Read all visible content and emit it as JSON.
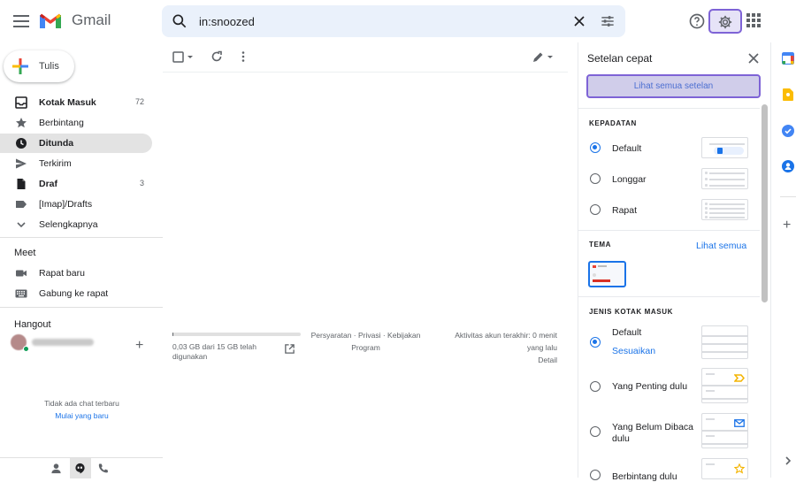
{
  "header": {
    "app_name": "Gmail",
    "search_value": "in:snoozed"
  },
  "sidebar": {
    "compose_label": "Tulis",
    "items": [
      {
        "label": "Kotak Masuk",
        "count": "72"
      },
      {
        "label": "Berbintang",
        "count": ""
      },
      {
        "label": "Ditunda",
        "count": ""
      },
      {
        "label": "Terkirim",
        "count": ""
      },
      {
        "label": "Draf",
        "count": "3"
      },
      {
        "label": "[Imap]/Drafts",
        "count": ""
      },
      {
        "label": "Selengkapnya",
        "count": ""
      }
    ],
    "meet_title": "Meet",
    "meet_items": [
      "Rapat baru",
      "Gabung ke rapat"
    ],
    "hangout_title": "Hangout",
    "hangout_contact": "",
    "no_chat_text": "Tidak ada chat terbaru",
    "start_chat_link": "Mulai yang baru"
  },
  "main": {
    "storage_line1": "0,03 GB dari 15 GB telah",
    "storage_line2": "digunakan",
    "storage_fraction": 0.002,
    "policy_line1": "Persyaratan · Privasi · Kebijakan",
    "policy_line2": "Program",
    "activity_line1": "Aktivitas akun terakhir: 0 menit",
    "activity_line2": "yang lalu",
    "activity_details": "Detail"
  },
  "quick_settings": {
    "title": "Setelan cepat",
    "see_all_button": "Lihat semua setelan",
    "density_title": "KEPADATAN",
    "density_options": [
      {
        "label": "Default",
        "selected": true
      },
      {
        "label": "Longgar",
        "selected": false
      },
      {
        "label": "Rapat",
        "selected": false
      }
    ],
    "theme_title": "TEMA",
    "theme_see_all": "Lihat semua",
    "inbox_title": "JENIS KOTAK MASUK",
    "inbox_options": [
      {
        "label": "Default",
        "selected": true,
        "sub_link": "Sesuaikan"
      },
      {
        "label": "Yang Penting dulu",
        "selected": false
      },
      {
        "label": "Yang Belum Dibaca dulu",
        "selected": false
      },
      {
        "label": "Berbintang dulu",
        "selected": false
      }
    ]
  },
  "colors": {
    "accent": "#1a73e8",
    "highlight_border": "#7e63d6",
    "highlight_fill": "#d0cdea",
    "search_bg": "#eaf1fb",
    "active_nav": "#e3e3e3"
  }
}
